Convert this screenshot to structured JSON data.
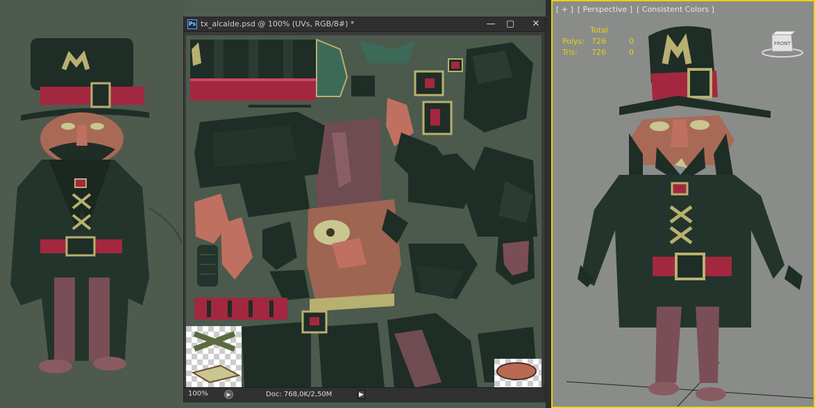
{
  "photoshop": {
    "logo": "Ps",
    "title": "tx_alcalde.psd @ 100% (UVs, RGB/8#) *",
    "window_controls": {
      "minimize": "—",
      "maximize": "▢",
      "close": "✕"
    },
    "status": {
      "zoom": "100%",
      "doc_info": "Doc: 768,0K/2,50M",
      "arrow": "▶",
      "status_icon": "▶"
    }
  },
  "viewport": {
    "label_parts": [
      "[ + ]",
      "[ Perspective ]",
      "[ Consistent Colors ]"
    ],
    "stats": {
      "header": "Total",
      "rows": [
        {
          "label": "Polys:",
          "value": "726",
          "extra": "0"
        },
        {
          "label": "Tris:",
          "value": "726",
          "extra": "0"
        }
      ]
    },
    "viewcube_label": "FRONT"
  },
  "colors": {
    "coat": "#23342c",
    "hat_band": "#a3283f",
    "skin": "#c07060",
    "gold": "#b8b070",
    "viewport_border": "#e8d10f"
  }
}
